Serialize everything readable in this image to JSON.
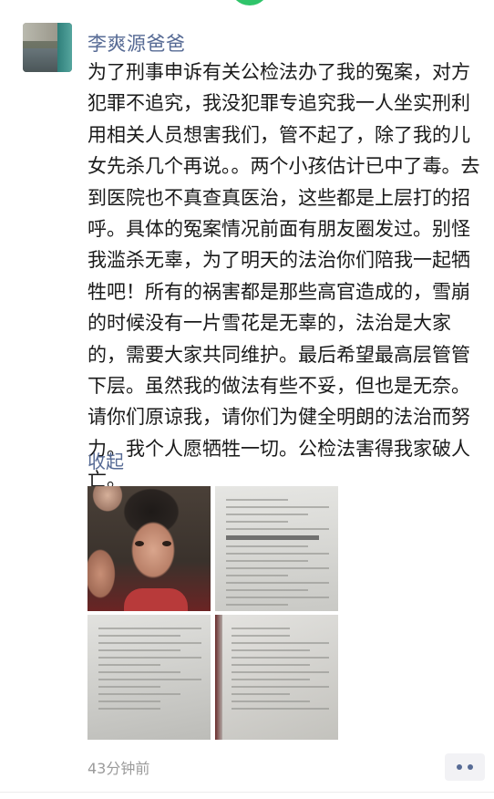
{
  "post": {
    "username": "李爽源爸爸",
    "text": "为了刑事申诉有关公检法办了我的冤案，对方犯罪不追究，我没犯罪专追究我一人坐实刑利用相关人员想害我们，管不起了，除了我的儿女先杀几个再说。。两个小孩估计已中了毒。去到医院也不真查真医治，这些都是上层打的招呼。具体的冤案情况前面有朋友圈发过。别怪我滥杀无辜，为了明天的法治你们陪我一起牺牲吧！所有的祸害都是那些高官造成的，雪崩的时候没有一片雪花是无辜的，法治是大家的，需要大家共同维护。最后希望最高层管管下层。虽然我的做法有些不妥，但也是无奈。请你们原谅我，请你们为健全明朗的法治而努力。我个人愿牺牲一切。公检法害得我家破人亡。",
    "collapse_label": "收起",
    "photos": [
      {
        "icon": "child-photo"
      },
      {
        "icon": "document-photo"
      },
      {
        "icon": "document-photo"
      },
      {
        "icon": "document-photo"
      }
    ],
    "time": "43分钟前",
    "more_icon": "more-dots-icon"
  },
  "colors": {
    "link": "#576b95",
    "text": "#1a1a1a",
    "meta": "#9b9b9b",
    "top_tab": "#2fc46a"
  }
}
